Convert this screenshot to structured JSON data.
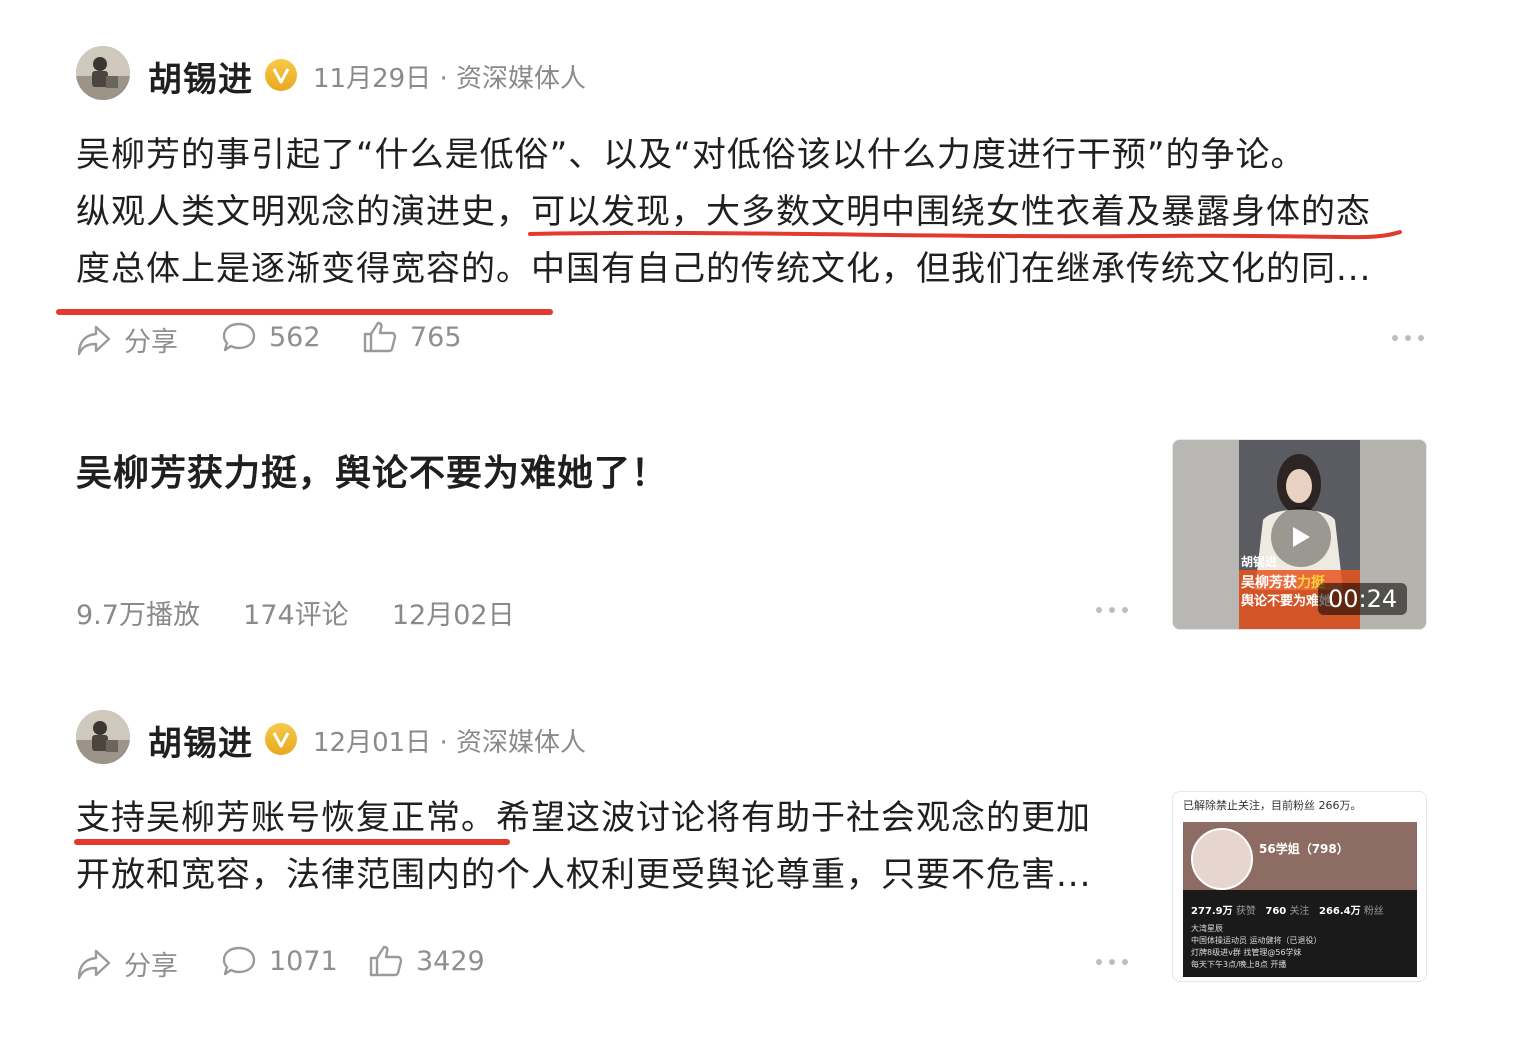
{
  "post1": {
    "author": "胡锡进",
    "date": "11月29日",
    "role": "资深媒体人",
    "lines": [
      "吴柳芳的事引起了“什么是低俗”、以及“对低俗该以什么力度进行干预”的争论。",
      "纵观人类文明观念的演进史，可以发现，大多数文明中围绕女性衣着及暴露身体的态",
      "度总体上是逐渐变得宽容的。中国有自己的传统文化，但我们在继承传统文化的同..."
    ],
    "share": "分享",
    "comments": "562",
    "likes": "765"
  },
  "video": {
    "title": "吴柳芳获力挺，舆论不要为难她了！",
    "plays": "9.7万播放",
    "comments": "174评论",
    "date": "12月02日",
    "duration": "00:24",
    "overlay_name": "胡锡进",
    "overlay_line1a": "吴柳芳获",
    "overlay_line1b": "力挺",
    "overlay_line2": "舆论不要为难她"
  },
  "post2": {
    "author": "胡锡进",
    "date": "12月01日",
    "role": "资深媒体人",
    "lines": [
      "支持吴柳芳账号恢复正常。希望这波讨论将有助于社会观念的更加",
      "开放和宽容，法律范围内的个人权利更受舆论尊重，只要不危害..."
    ],
    "share": "分享",
    "comments": "1071",
    "likes": "3429",
    "thumb": {
      "note": "已解除禁止关注，目前粉丝 266万。",
      "profile_name": "56学姐（798）",
      "stat1_value": "277.9万",
      "stat1_label": "获赞",
      "stat2_value": "760",
      "stat2_label": "关注",
      "stat3_value": "266.4万",
      "stat3_label": "粉丝",
      "bio1": "大湾星辰",
      "bio2": "中国体操运动员 运动健将（已退役）",
      "bio3": "灯牌8级进v群 找管理@56学妹",
      "bio4": "每天下午3点/晚上8点 开播"
    }
  },
  "colors": {
    "accent_red": "#e23b2e",
    "gray_text": "#8a8a8a",
    "badge_gold": "#f0b429"
  }
}
